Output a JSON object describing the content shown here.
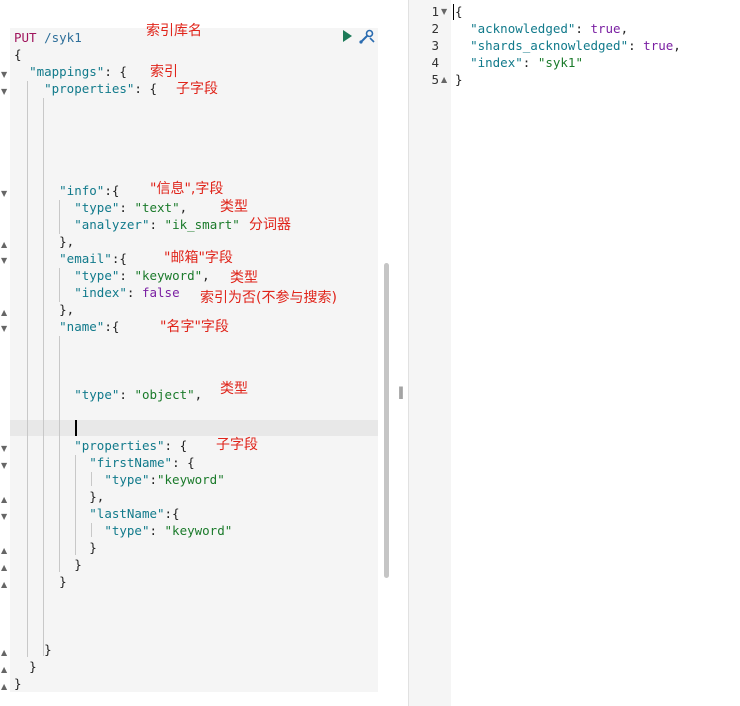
{
  "request": {
    "method": "PUT",
    "path": "/syk1",
    "lines": {
      "l2": "{",
      "mappings_key": "\"mappings\"",
      "mappings_rest": ": {",
      "properties_key": "\"properties\"",
      "properties_rest": ": {",
      "info_key": "\"info\"",
      "info_rest": ":{",
      "info_type_key": "\"type\"",
      "info_type_val": "\"text\"",
      "info_analyzer_key": "\"analyzer\"",
      "info_analyzer_val": "\"ik_smart\"",
      "info_close": "},",
      "email_key": "\"email\"",
      "email_rest": ":{",
      "email_type_key": "\"type\"",
      "email_type_val": "\"keyword\"",
      "email_index_key": "\"index\"",
      "email_index_val": "false",
      "email_close": "},",
      "name_key": "\"name\"",
      "name_rest": ":{",
      "name_type_key": "\"type\"",
      "name_type_val": "\"object\"",
      "name_props_key": "\"properties\"",
      "name_props_rest": ": {",
      "first_key": "\"firstName\"",
      "first_rest": ": {",
      "first_type_key": "\"type\"",
      "first_type_val": "\"keyword\"",
      "first_close": "},",
      "last_key": "\"lastName\"",
      "last_rest": ":{",
      "last_type_key": "\"type\"",
      "last_type_val": "\"keyword\"",
      "close": "}"
    }
  },
  "annotations": {
    "index_name": "索引库名",
    "index": "索引",
    "subfields": "子字段",
    "info_field": "\"信息\",字段",
    "type1": "类型",
    "analyzer": "分词器",
    "email_field": "\"邮箱\"字段",
    "type2": "类型",
    "not_indexed": "索引为否(不参与搜索)",
    "name_field": "\"名字\"字段",
    "type3": "类型",
    "subfields2": "子字段"
  },
  "response": {
    "line_numbers": [
      "1",
      "2",
      "3",
      "4",
      "5"
    ],
    "l1": "{",
    "ack_key": "\"acknowledged\"",
    "ack_val": "true",
    "shards_key": "\"shards_acknowledged\"",
    "shards_val": "true",
    "index_key": "\"index\"",
    "index_val": "\"syk1\"",
    "l5": "}"
  },
  "toolbar": {
    "run_icon": "play-icon",
    "settings_icon": "wrench-icon"
  },
  "colors": {
    "annotation": "#e0241a",
    "method": "#a0155d",
    "string": "#1a7a2a",
    "key": "#117a8b",
    "run": "#1c7a58"
  }
}
